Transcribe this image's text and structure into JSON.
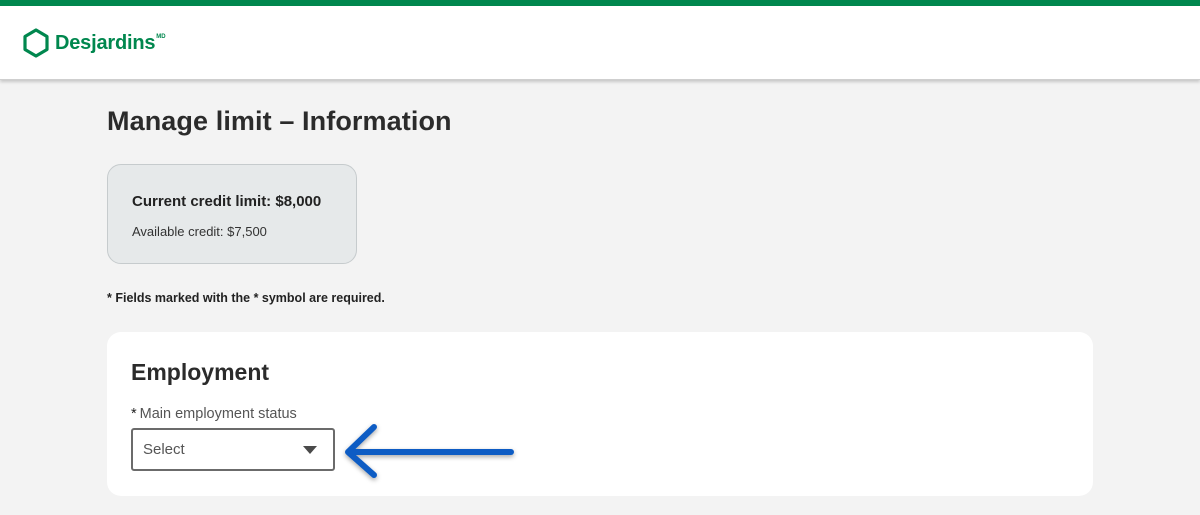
{
  "header": {
    "brand_name": "Desjardins",
    "brand_mark": "MD",
    "brand_color": "#00874e"
  },
  "page": {
    "title": "Manage limit – Information"
  },
  "credit_summary": {
    "current_limit": "Current credit limit: $8,000",
    "available_credit": "Available credit: $7,500"
  },
  "required_note": "* Fields marked with the * symbol are required.",
  "employment": {
    "section_title": "Employment",
    "status_field": {
      "required_marker": "*",
      "label": "Main employment status",
      "value": "Select"
    }
  },
  "annotation": {
    "arrow_color": "#0a5bc4",
    "icon": "left-arrow-icon"
  }
}
